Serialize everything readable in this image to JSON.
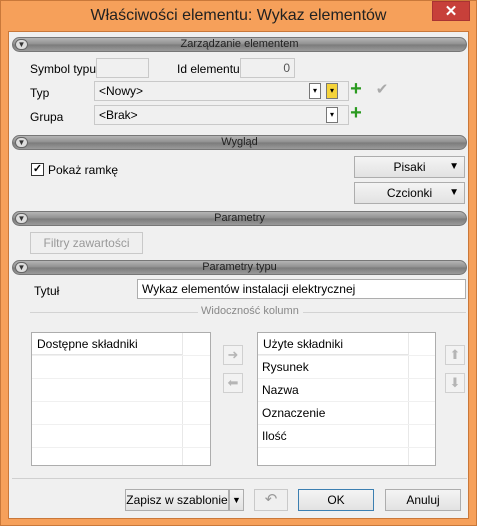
{
  "window": {
    "title": "Właściwości elementu: Wykaz elementów",
    "close": "✕"
  },
  "sections": {
    "management": "Zarządzanie elementem",
    "appearance": "Wygląd",
    "parameters": "Parametry",
    "type_parameters": "Parametry typu"
  },
  "management": {
    "symbol_label": "Symbol typu",
    "symbol_value": "",
    "id_label": "Id elementu",
    "id_value": "0",
    "type_label": "Typ",
    "type_value": "<Nowy>",
    "group_label": "Grupa",
    "group_value": "<Brak>"
  },
  "appearance": {
    "show_frame_label": "Pokaż ramkę",
    "show_frame_checked": true,
    "pens_button": "Pisaki",
    "fonts_button": "Czcionki"
  },
  "parameters": {
    "content_filters_button": "Filtry zawartości"
  },
  "type_parameters": {
    "title_label": "Tytuł",
    "title_value": "Wykaz elementów instalacji elektrycznej",
    "column_visibility_label": "Widoczność kolumn",
    "available_header": "Dostępne składniki",
    "available_items": [],
    "used_header": "Użyte składniki",
    "used_items": [
      "Rysunek",
      "Nazwa",
      "Oznaczenie",
      "Ilość"
    ]
  },
  "footer": {
    "save_template_button": "Zapisz w szablonie",
    "ok_button": "OK",
    "cancel_button": "Anuluj"
  },
  "colors": {
    "frame": "#f6a05a",
    "close": "#c7403a",
    "plus": "#2a9a1f"
  },
  "icons": {
    "section": "chevron-down-icon",
    "move_right": "arrow-right-icon",
    "move_left": "arrow-left-icon",
    "move_up": "arrow-up-icon",
    "move_down": "arrow-down-icon",
    "undo": "undo-icon"
  }
}
